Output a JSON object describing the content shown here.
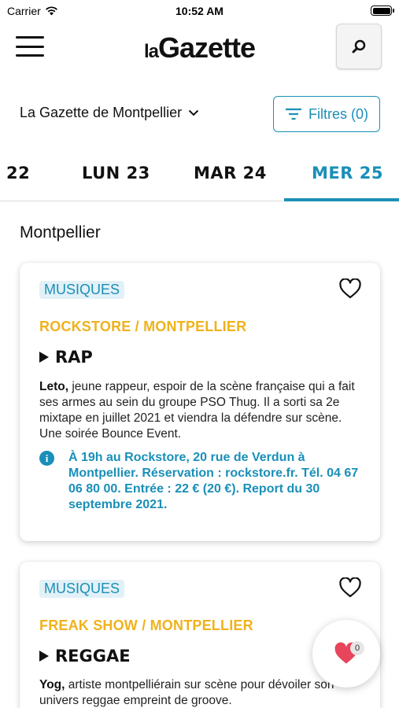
{
  "status_bar": {
    "carrier": "Carrier",
    "time": "10:52 AM"
  },
  "header": {
    "logo_prefix": "la",
    "logo_main": "Gazette"
  },
  "city_selector": {
    "value": "La Gazette de Montpellier"
  },
  "filter_button": {
    "label": "Filtres (0)"
  },
  "day_tabs": [
    {
      "label": "22",
      "active": false
    },
    {
      "label": "LUN 23",
      "active": false
    },
    {
      "label": "MAR 24",
      "active": false
    },
    {
      "label": "MER 25",
      "active": true
    }
  ],
  "section": {
    "title": "Montpellier"
  },
  "events": [
    {
      "category": "MUSIQUES",
      "venue": "ROCKSTORE / MONTPELLIER",
      "genre": "RAP",
      "artist": "Leto,",
      "description": " jeune rappeur, espoir de la scène française qui a fait ses armes au sein du groupe PSO Thug. Il a sorti sa 2e mixtape en juillet 2021 et viendra la défendre sur scène. Une soirée Bounce Event.",
      "info": "À 19h au Rockstore, 20 rue de Verdun à Montpellier. Réservation : rockstore.fr. Tél. 04 67 06 80 00. Entrée : 22 € (20 €). Report du 30 septembre 2021."
    },
    {
      "category": "MUSIQUES",
      "venue": "FREAK SHOW / MONTPELLIER",
      "genre": "REGGAE",
      "artist": "Yog,",
      "description": " artiste montpelliérain sur scène pour dévoiler son univers reggae empreint de groove."
    }
  ],
  "favorites": {
    "count": "0"
  },
  "colors": {
    "accent": "#1a8fb8",
    "venue": "#f0b21c",
    "heart": "#e8455d"
  }
}
